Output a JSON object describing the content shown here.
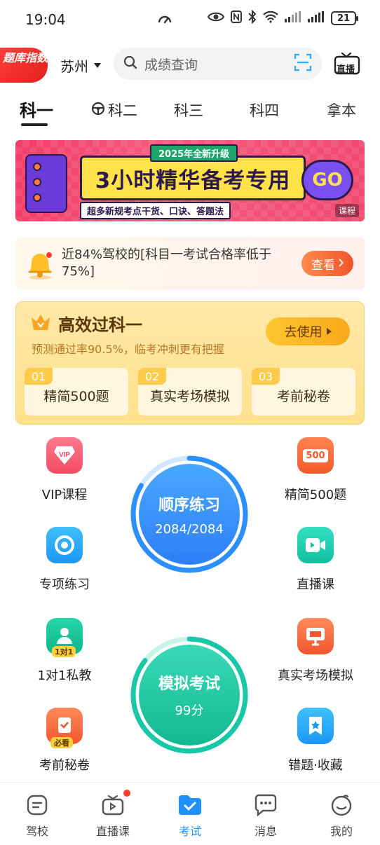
{
  "status_bar": {
    "time": "19:04",
    "battery": "21"
  },
  "header": {
    "index_badge": "题库指数",
    "city": "苏州",
    "search_placeholder": "成绩查询",
    "live_label": "直播"
  },
  "tabs": [
    {
      "label": "科一",
      "active": true
    },
    {
      "label": "科二",
      "active": false
    },
    {
      "label": "科三",
      "active": false
    },
    {
      "label": "科四",
      "active": false
    },
    {
      "label": "拿本",
      "active": false
    }
  ],
  "banner": {
    "top_tag": "2025年全新升级",
    "headline": "3小时精华备考专用",
    "bottom_tag": "超多新规考点干货、口诀、答题法",
    "go": "GO",
    "corner_tag": "课程"
  },
  "notice": {
    "text": "近84%驾校的[科目一考试合格率低于75%]",
    "button": "查看"
  },
  "pass_card": {
    "title": "高效过科一",
    "subtitle": "预测通过率90.5%，临考冲刺更有把握",
    "use_button": "去使用",
    "features": [
      {
        "num": "01",
        "label": "精简500题"
      },
      {
        "num": "02",
        "label": "真实考场模拟"
      },
      {
        "num": "03",
        "label": "考前秘卷"
      }
    ]
  },
  "grid": {
    "left": [
      {
        "label": "VIP课程",
        "icon": "vip-icon"
      },
      {
        "label": "专项练习",
        "icon": "target-icon"
      },
      {
        "label": "1对1私教",
        "icon": "tutor-icon",
        "badge": "1对1"
      },
      {
        "label": "考前秘卷",
        "icon": "secret-paper-icon",
        "badge": "必看"
      }
    ],
    "right": [
      {
        "label": "精简500题",
        "icon": "500-icon",
        "badge": "500"
      },
      {
        "label": "直播课",
        "icon": "video-icon"
      },
      {
        "label": "真实考场模拟",
        "icon": "monitor-icon"
      },
      {
        "label": "错题·收藏",
        "icon": "bookmark-icon"
      }
    ]
  },
  "practice_circle": {
    "title": "顺序练习",
    "progress": "2084/2084"
  },
  "exam_circle": {
    "title": "模拟考试",
    "score": "99分"
  },
  "bottom_nav": [
    {
      "label": "驾校",
      "icon": "school-icon",
      "active": false
    },
    {
      "label": "直播课",
      "icon": "live-icon",
      "active": false,
      "dot": true
    },
    {
      "label": "考试",
      "icon": "exam-icon",
      "active": true
    },
    {
      "label": "消息",
      "icon": "message-icon",
      "active": false
    },
    {
      "label": "我的",
      "icon": "profile-icon",
      "active": false
    }
  ],
  "colors": {
    "accent_blue": "#1e90ff",
    "accent_teal": "#17c7a5",
    "notice_orange": "#f0562b",
    "gold": "#ffc531"
  }
}
